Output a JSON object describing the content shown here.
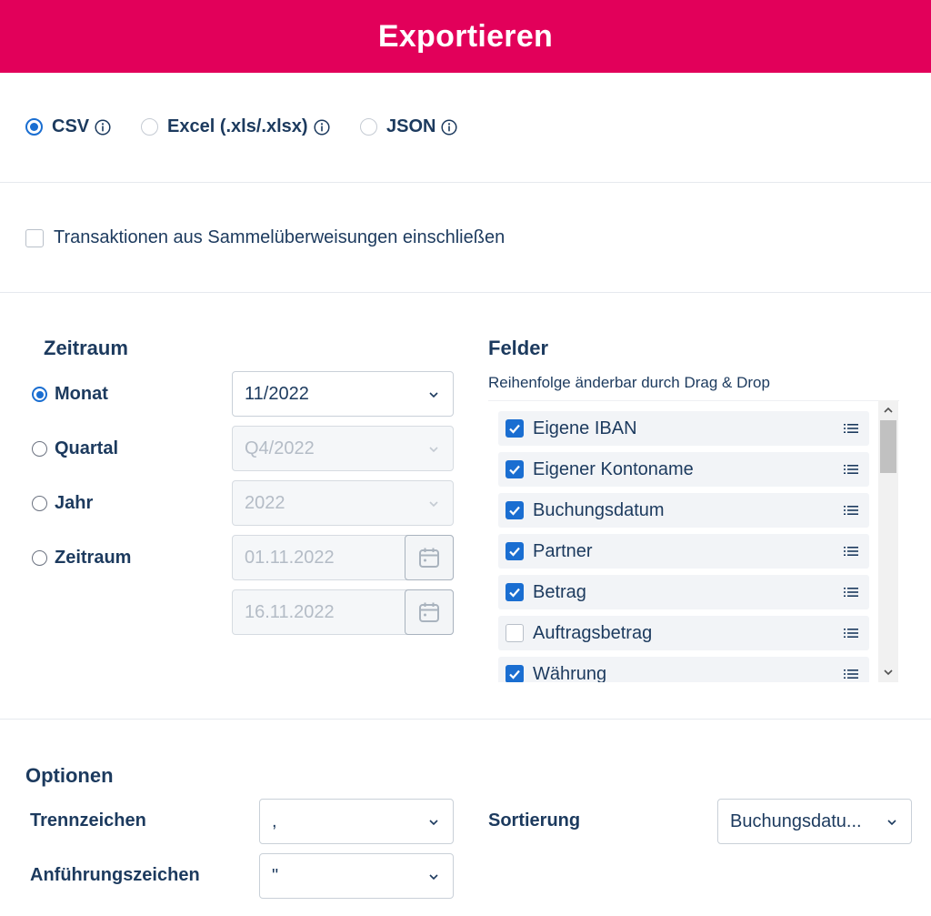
{
  "header": {
    "title": "Exportieren"
  },
  "formats": [
    {
      "label": "CSV",
      "selected": true
    },
    {
      "label": "Excel (.xls/.xlsx)",
      "selected": false
    },
    {
      "label": "JSON",
      "selected": false
    }
  ],
  "sammel": {
    "label": "Transaktionen aus Sammelüberweisungen einschließen",
    "checked": false
  },
  "zeitraum": {
    "title": "Zeitraum",
    "options": [
      {
        "label": "Monat",
        "selected": true,
        "value": "11/2022"
      },
      {
        "label": "Quartal",
        "selected": false,
        "value": "Q4/2022"
      },
      {
        "label": "Jahr",
        "selected": false,
        "value": "2022"
      },
      {
        "label": "Zeitraum",
        "selected": false,
        "from": "01.11.2022",
        "to": "16.11.2022"
      }
    ]
  },
  "felder": {
    "title": "Felder",
    "subtitle": "Reihenfolge änderbar durch Drag & Drop",
    "items": [
      {
        "label": "Eigene IBAN",
        "checked": true
      },
      {
        "label": "Eigener Kontoname",
        "checked": true
      },
      {
        "label": "Buchungsdatum",
        "checked": true
      },
      {
        "label": "Partner",
        "checked": true
      },
      {
        "label": "Betrag",
        "checked": true
      },
      {
        "label": "Auftragsbetrag",
        "checked": false
      },
      {
        "label": "Währung",
        "checked": true
      }
    ]
  },
  "optionen": {
    "title": "Optionen",
    "trennzeichen": {
      "label": "Trennzeichen",
      "value": ","
    },
    "anfuehrungszeichen": {
      "label": "Anführungszeichen",
      "value": "\""
    },
    "sortierung": {
      "label": "Sortierung",
      "value": "Buchungsdatu..."
    }
  },
  "colors": {
    "brand": "#e2005a",
    "accent": "#1a6ed1",
    "text": "#1c3a5e"
  }
}
